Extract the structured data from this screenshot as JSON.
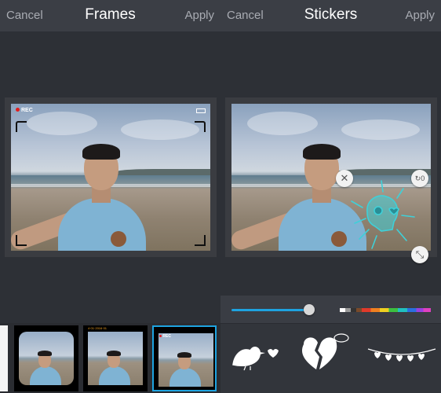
{
  "frames_screen": {
    "cancel_label": "Cancel",
    "title": "Frames",
    "apply_label": "Apply",
    "rec_label": "REC",
    "thumbs": [
      {
        "name": "frame-thumb-plain"
      },
      {
        "name": "frame-thumb-rounded"
      },
      {
        "name": "frame-thumb-camera-orange"
      },
      {
        "name": "frame-thumb-rec",
        "selected": true
      }
    ],
    "mini_rec_label": "REC",
    "mini_top_label": "4·01·2016·01"
  },
  "stickers_screen": {
    "cancel_label": "Cancel",
    "title": "Stickers",
    "apply_label": "Apply",
    "close_icon": "close-icon",
    "rotate_icon": "rotate-icon",
    "rotate_label": "0",
    "resize_icon": "resize-icon",
    "size_slider_fraction": 0.9,
    "sticker_library": [
      "bird-heart-sticker",
      "broken-heart-sticker",
      "bunting-hearts-sticker"
    ]
  },
  "colors": {
    "topbar_bg": "#3b3e45",
    "selection_accent": "#1ea3e0",
    "rec_dot": "#e21c1c",
    "sticker_line": "#3fd0d8"
  }
}
